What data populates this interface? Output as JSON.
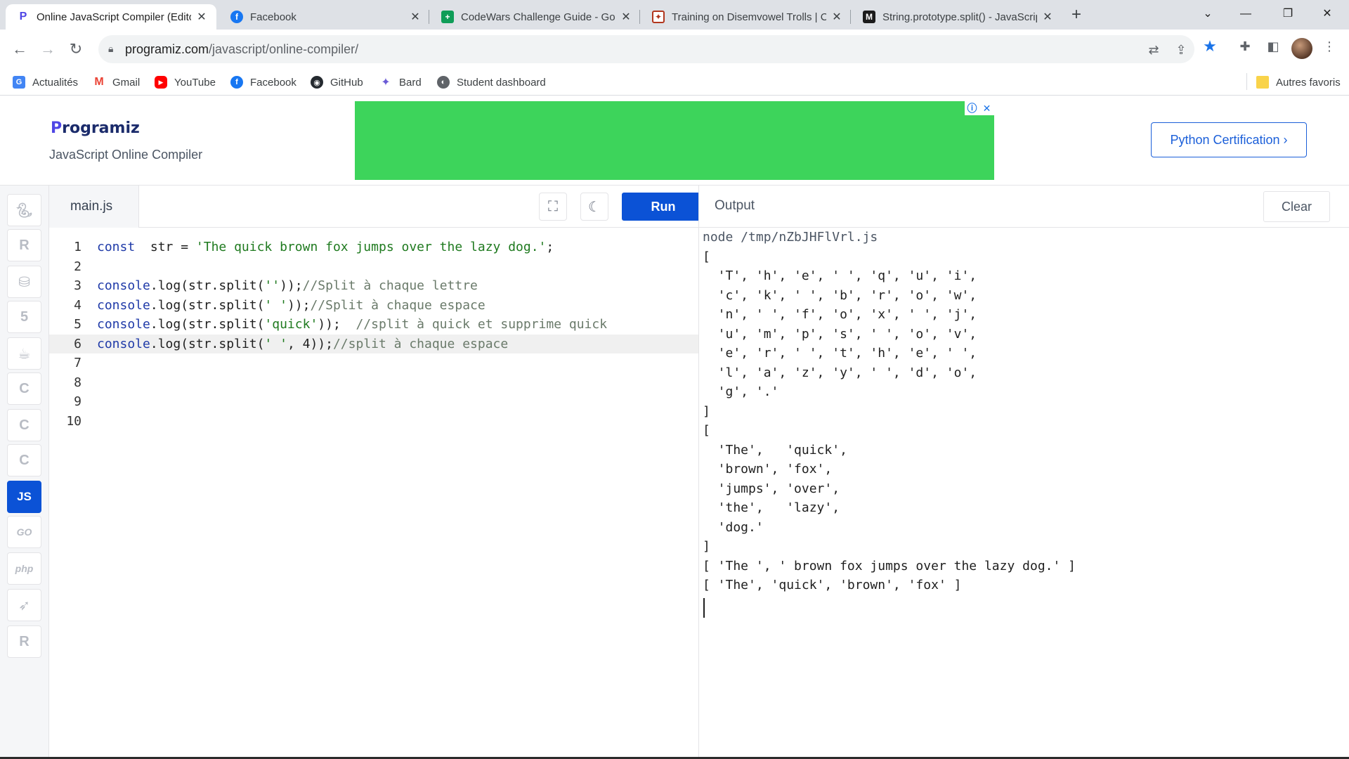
{
  "browser": {
    "tabs": [
      {
        "title": "Online JavaScript Compiler (Edito",
        "favicon": "programiz-icon",
        "active": true
      },
      {
        "title": "Facebook",
        "favicon": "facebook-icon",
        "active": false
      },
      {
        "title": "CodeWars Challenge Guide - Goo",
        "favicon": "sheets-icon",
        "active": false
      },
      {
        "title": "Training on Disemvowel Trolls | C",
        "favicon": "codewars-icon",
        "active": false
      },
      {
        "title": "String.prototype.split() - JavaScrip",
        "favicon": "mdn-icon",
        "active": false
      }
    ],
    "url_domain": "programiz.com",
    "url_path": "/javascript/online-compiler/",
    "bookmarks": [
      {
        "label": "Actualités",
        "icon": "news-icon"
      },
      {
        "label": "Gmail",
        "icon": "gmail-icon"
      },
      {
        "label": "YouTube",
        "icon": "youtube-icon"
      },
      {
        "label": "Facebook",
        "icon": "facebook-icon"
      },
      {
        "label": "GitHub",
        "icon": "github-icon"
      },
      {
        "label": "Bard",
        "icon": "bard-icon"
      },
      {
        "label": "Student dashboard",
        "icon": "dashboard-icon"
      }
    ],
    "other_bookmarks": "Autres favoris"
  },
  "header": {
    "logo_text": "rogramiz",
    "logo_mark": "P",
    "subtitle": "JavaScript Online Compiler",
    "cert_button": "Python Certification ›"
  },
  "languages": [
    {
      "name": "python-lang-icon",
      "label": "",
      "active": false
    },
    {
      "name": "r-lang-icon",
      "label": "R",
      "active": false
    },
    {
      "name": "sql-lang-icon",
      "label": "",
      "active": false
    },
    {
      "name": "html-lang-icon",
      "label": "5",
      "active": false
    },
    {
      "name": "java-lang-icon",
      "label": "",
      "active": false
    },
    {
      "name": "c-lang-icon",
      "label": "C",
      "active": false
    },
    {
      "name": "cpp-lang-icon",
      "label": "C",
      "active": false
    },
    {
      "name": "csharp-lang-icon",
      "label": "C",
      "active": false
    },
    {
      "name": "js-lang-icon",
      "label": "JS",
      "active": true
    },
    {
      "name": "go-lang-icon",
      "label": "GO",
      "active": false
    },
    {
      "name": "php-lang-icon",
      "label": "php",
      "active": false
    },
    {
      "name": "swift-lang-icon",
      "label": "",
      "active": false
    },
    {
      "name": "rust-lang-icon",
      "label": "R",
      "active": false
    }
  ],
  "editor": {
    "filename": "main.js",
    "run_label": "Run",
    "active_line": 6,
    "lines": [
      {
        "n": "1",
        "tokens": [
          [
            "kw",
            "const"
          ],
          [
            "",
            "  str = "
          ],
          [
            "str",
            "'The quick brown fox jumps over the lazy dog.'"
          ],
          [
            "",
            ";"
          ]
        ]
      },
      {
        "n": "2",
        "tokens": []
      },
      {
        "n": "3",
        "tokens": [
          [
            "kw",
            "console"
          ],
          [
            "",
            ".log(str.split("
          ],
          [
            "str",
            "''"
          ],
          [
            "",
            "));"
          ],
          [
            "cmt",
            "//Split à chaque lettre"
          ]
        ]
      },
      {
        "n": "4",
        "tokens": [
          [
            "kw",
            "console"
          ],
          [
            "",
            ".log(str.split("
          ],
          [
            "str",
            "' '"
          ],
          [
            "",
            "));"
          ],
          [
            "cmt",
            "//Split à chaque espace"
          ]
        ]
      },
      {
        "n": "5",
        "tokens": [
          [
            "kw",
            "console"
          ],
          [
            "",
            ".log(str.split("
          ],
          [
            "str",
            "'quick'"
          ],
          [
            "",
            "));  "
          ],
          [
            "cmt",
            "//split à quick et supprime quick"
          ]
        ]
      },
      {
        "n": "6",
        "tokens": [
          [
            "kw",
            "console"
          ],
          [
            "",
            ".log(str.split("
          ],
          [
            "str",
            "' '"
          ],
          [
            "",
            ", 4));"
          ],
          [
            "cmt",
            "//split à chaque espace"
          ]
        ]
      },
      {
        "n": "7",
        "tokens": []
      },
      {
        "n": "8",
        "tokens": []
      },
      {
        "n": "9",
        "tokens": []
      },
      {
        "n": "10",
        "tokens": []
      }
    ]
  },
  "output": {
    "title": "Output",
    "clear_label": "Clear",
    "command": "node /tmp/nZbJHFlVrl.js",
    "lines": [
      "[",
      "  'T', 'h', 'e', ' ', 'q', 'u', 'i',",
      "  'c', 'k', ' ', 'b', 'r', 'o', 'w',",
      "  'n', ' ', 'f', 'o', 'x', ' ', 'j',",
      "  'u', 'm', 'p', 's', ' ', 'o', 'v',",
      "  'e', 'r', ' ', 't', 'h', 'e', ' ',",
      "  'l', 'a', 'z', 'y', ' ', 'd', 'o',",
      "  'g', '.'",
      "]",
      "[",
      "  'The',   'quick',",
      "  'brown', 'fox',",
      "  'jumps', 'over',",
      "  'the',   'lazy',",
      "  'dog.'",
      "]",
      "[ 'The ', ' brown fox jumps over the lazy dog.' ]",
      "[ 'The', 'quick', 'brown', 'fox' ]"
    ]
  }
}
